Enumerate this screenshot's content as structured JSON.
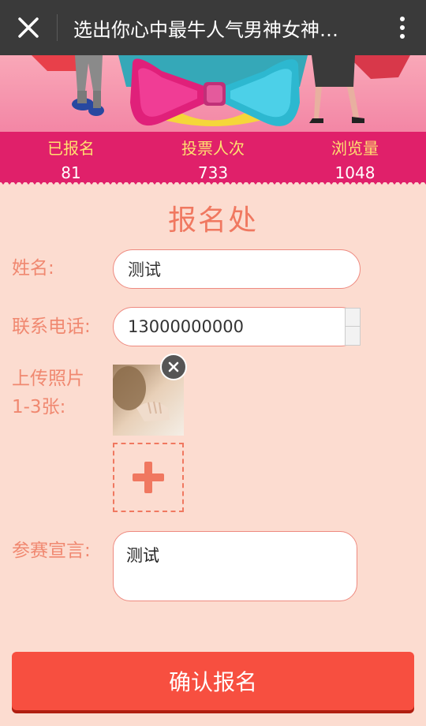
{
  "topbar": {
    "title": "选出你心中最牛人气男神女神…",
    "close_icon": "close-icon",
    "more_icon": "more-vertical-icon"
  },
  "stats": [
    {
      "label": "已报名",
      "value": "81"
    },
    {
      "label": "投票人次",
      "value": "733"
    },
    {
      "label": "浏览量",
      "value": "1048"
    }
  ],
  "form": {
    "title": "报名处",
    "name_label": "姓名:",
    "name_value": "测试",
    "phone_label": "联系电话:",
    "phone_value": "13000000000",
    "photo_label_line1": "上传照片",
    "photo_label_line2": "1-3张:",
    "declaration_label": "参赛宣言:",
    "declaration_value": "测试",
    "submit_label": "确认报名"
  },
  "colors": {
    "topbar": "#3a3a3a",
    "stats_bg": "#e0206a",
    "stats_label": "#ffe070",
    "page_bg": "#fcdcd0",
    "accent": "#f07860",
    "submit": "#f74f40"
  }
}
